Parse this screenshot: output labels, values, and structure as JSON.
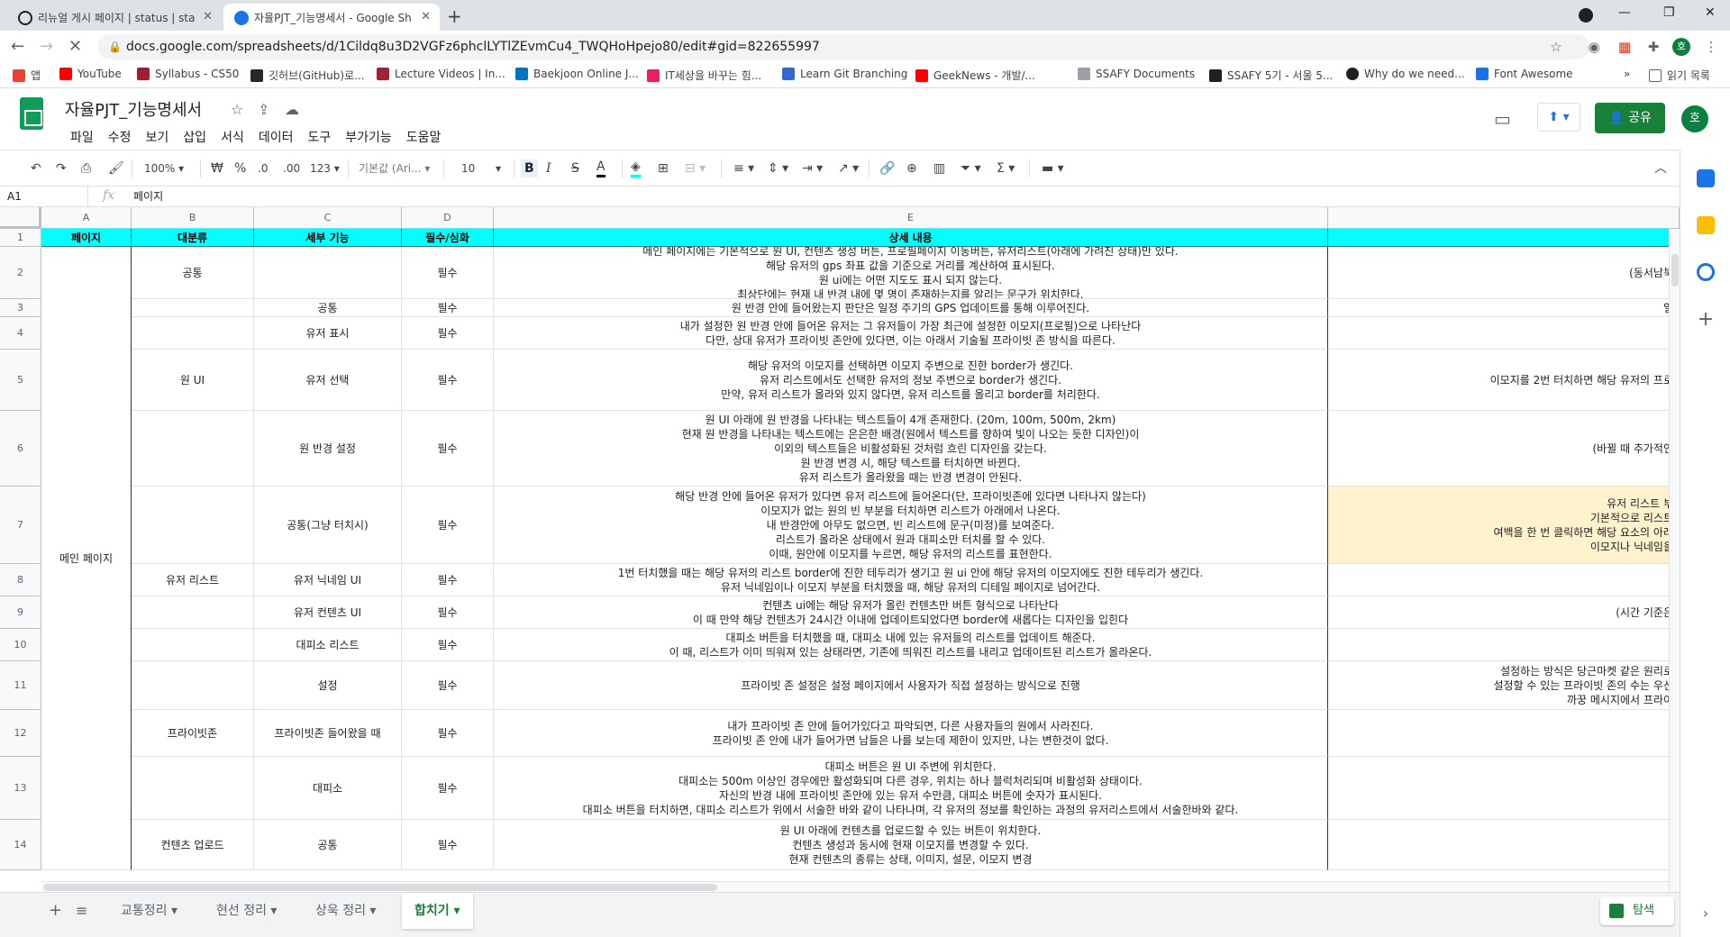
{
  "browser": {
    "tabs": [
      {
        "title": "리뉴얼 게시 페이지 | status | sta",
        "active": false
      },
      {
        "title": "자율PJT_기능명세서 - Google Sh",
        "active": true
      }
    ],
    "url": "docs.google.com/spreadsheets/d/1Cildq8u3D2VGFz6phclLYTlZEvmCu4_TWQHoHpejo80/edit#gid=822655997",
    "bookmarks": [
      "앱",
      "YouTube",
      "Syllabus - CS50",
      "깃허브(GitHub)로...",
      "Lecture Videos | In...",
      "Baekjoon Online J...",
      "IT세상을 바꾸는 힘...",
      "Learn Git Branching",
      "GeekNews - 개발/...",
      "SSAFY Documents",
      "SSAFY 5기 - 서울 5...",
      "Why do we need...",
      "Font Awesome"
    ],
    "reading_list": "읽기 목록",
    "profile_initial": "호"
  },
  "sheets": {
    "title": "자율PJT_기능명세서",
    "menu": [
      "파일",
      "수정",
      "보기",
      "삽입",
      "서식",
      "데이터",
      "도구",
      "부가기능",
      "도움말"
    ],
    "share_label": "공유",
    "avatar_initial": "호",
    "toolbar": {
      "zoom": "100%",
      "currency": "₩",
      "percent": "%",
      "dec_less": ".0",
      "dec_more": ".00",
      "format_more": "123",
      "font": "기본값 (Ari...",
      "font_size": "10"
    },
    "namebox": "A1",
    "formula": "페이지",
    "columns": [
      "A",
      "B",
      "C",
      "D",
      "E"
    ],
    "header_row": [
      "페이지",
      "대분류",
      "세부 기능",
      "필수/심화",
      "상세 내용"
    ],
    "rows": [
      {
        "num": "2",
        "b": "공통",
        "c": "",
        "d": "필수",
        "e": "메인 페이지에는 기본적으로 원 UI, 컨텐츠 생성 버튼, 프로필페이지 이동버튼, 유저리스트(아래에 가려진 상태)만 있다.\n해당 유저의 gps 좌표 값을 기준으로 거리를 계산하여 표시된다.\n원 ui에는 어떤 지도도 표시 되지 않는다.\n최상단에는 현재 내 반경 내에 몇 명이 존재하는지를 알리는 문구가 위치한다.",
        "f": "(동서남북"
      },
      {
        "num": "3",
        "b": "",
        "c": "공통",
        "d": "필수",
        "e": "원 반경 안에 들어왔는지 판단은 일정 주기의 GPS 업데이트를 통해 이루어진다.",
        "f": "일"
      },
      {
        "num": "4",
        "b": "",
        "c": "유저 표시",
        "d": "필수",
        "e": "내가 설정한 원 반경 안에 들어온 유저는 그 유저들이 가장 최근에 설정한 이모지(프로필)으로 나타난다\n다만, 상대 유저가 프라이빗 존안에 있다면, 이는 아래서 기술될 프라이빗 존 방식을 따른다.",
        "f": ""
      },
      {
        "num": "5",
        "b": "원 UI",
        "c": "유저 선택",
        "d": "필수",
        "e": "해당 유저의 이모지를 선택하면 이모지 주변으로 진한 border가 생긴다.\n유저 리스트에서도 선택한 유저의 정보 주변으로 border가 생긴다.\n만약, 유저 리스트가 올라와 있지 않다면, 유저 리스트를 올리고 border를 처리한다.",
        "f": "이모지를 2번 터치하면 해당 유저의 프로"
      },
      {
        "num": "6",
        "b": "",
        "c": "원 반경 설정",
        "d": "필수",
        "e": "원 UI 아래에 원 반경을 나타내는 텍스트들이 4개 존재한다. (20m, 100m, 500m, 2km)\n현재 원 반경을 나타내는 텍스트에는 은은한 배경(원에서 텍스트를 향하여 빛이 나오는 듯한 디자인)이\n이외의 텍스트들은 비활성화된 것처럼 흐린 디자인을 갖는다.\n원 반경 변경 시, 해당 텍스트를 터치하면 바뀐다.\n유저 리스트가 올라왔을 때는 반경 변경이 안된다.",
        "f": "(바뀔 때 추가적인"
      },
      {
        "num": "7",
        "b": "",
        "c": "공통(그냥 터치시)",
        "d": "필수",
        "e": "해당 반경 안에 들어온 유저가 있다면 유저 리스트에 들어온다(단, 프라이빗존에 있다면 나타나지 않는다)\n이모지가 없는 원의 빈 부분을 터치하면 리스트가 아래에서 나온다.\n내 반경안에 아무도 없으면, 빈 리스트에 문구(미정)를 보여준다.\n리스트가 올라온 상태에서 원과 대피소만 터치를 할 수 있다.\n이때, 원안에 이모지를 누르면, 해당 유저의 리스트를 표현한다.",
        "f": "유저 리스트 부\n기본적으로 리스트\n여백을 한 번 클릭하면 해당 요소의 아래\n이모지나 닉네임을 "
      },
      {
        "num": "8",
        "b": "유저 리스트",
        "c": "유저 닉네임 UI",
        "d": "필수",
        "e": "1번 터치했을 때는 해당 유저의 리스트 border에 진한 테두리가 생기고 원 ui 안에 해당 유저의 이모지에도 진한 테두리가 생긴다.\n유저 닉네임이나 이모지 부분을 터치했을 때, 해당 유저의 디테일 페이지로 넘어간다.",
        "f": ""
      },
      {
        "num": "9",
        "b": "",
        "c": "유저 컨텐츠 UI",
        "d": "필수",
        "e": "컨텐츠 ui에는 해당 유저가 올린 컨텐츠만 버튼 형식으로 나타난다\n이 때 만약 해당 컨텐츠가 24시간 이내에 업데이트되었다면 border에 새롭다는 디자인을 입힌다",
        "f": "(시간 기준은"
      },
      {
        "num": "10",
        "b": "",
        "c": "대피소 리스트",
        "d": "필수",
        "e": "대피소 버튼을 터치했을 때, 대피소 내에 있는 유저들의 리스트를 업데이트 해준다.\n이 때, 리스트가 이미 띄워져 있는 상태라면, 기존에 띄워진 리스트를 내리고 업데이트된 리스트가 올라온다.",
        "f": ""
      },
      {
        "num": "11",
        "b": "",
        "c": "설정",
        "d": "필수",
        "e": "프라이빗 존 설정은 설정 페이지에서 사용자가 직접 설정하는 방식으로 진행",
        "f": "설정하는 방식은 당근마켓 같은 원리로\n설정할 수 있는 프라이빗 존의 수는 우선\n까꿍 메시지에서 프라이"
      },
      {
        "num": "12",
        "b": "프라이빗존",
        "c": "프라이빗존 들어왔을 때",
        "d": "필수",
        "e": "내가 프라이빗 존 안에 들어가있다고 파악되면, 다른 사용자들의 원에서 사라진다.\n프라이빗 존 안에 내가 들어가면 남들은 나를 보는데 제한이 있지만, 나는 변한것이 없다.",
        "f": ""
      },
      {
        "num": "13",
        "b": "",
        "c": "대피소",
        "d": "필수",
        "e": "대피소 버튼은 원 UI 주변에 위치한다.\n대피소는 500m 이상인 경우에만 활성화되며 다른 경우, 위치는 하나 블럭처리되며 비활성화 상태이다.\n자신의 반경 내에 프라이빗 존안에 있는 유저 수만큼, 대피소 버튼에 숫자가 표시된다.\n대피소 버튼을 터치하면, 대피소 리스트가 위에서 서술한 바와 같이 나타나며, 각 유저의 정보를 확인하는 과정의 유저리스트에서 서술한바와 같다.",
        "f": ""
      },
      {
        "num": "14",
        "b": "컨텐츠 업로드",
        "c": "공통",
        "d": "필수",
        "e": "원 UI 아래에 컨텐츠를 업로드할 수 있는 버튼이 위치한다.\n컨텐츠 생성과 동시에 현재 이모지를 변경할 수 있다.\n현재 컨텐츠의 종류는 상태, 이미지, 설문, 이모지 변경",
        "f": ""
      }
    ],
    "merged_page_label": "메인 페이지",
    "sheet_tabs": [
      "교통정리",
      "현선 정리",
      "상욱 정리",
      "합치기"
    ],
    "active_sheet": "합치기",
    "explore_label": "탐색"
  }
}
